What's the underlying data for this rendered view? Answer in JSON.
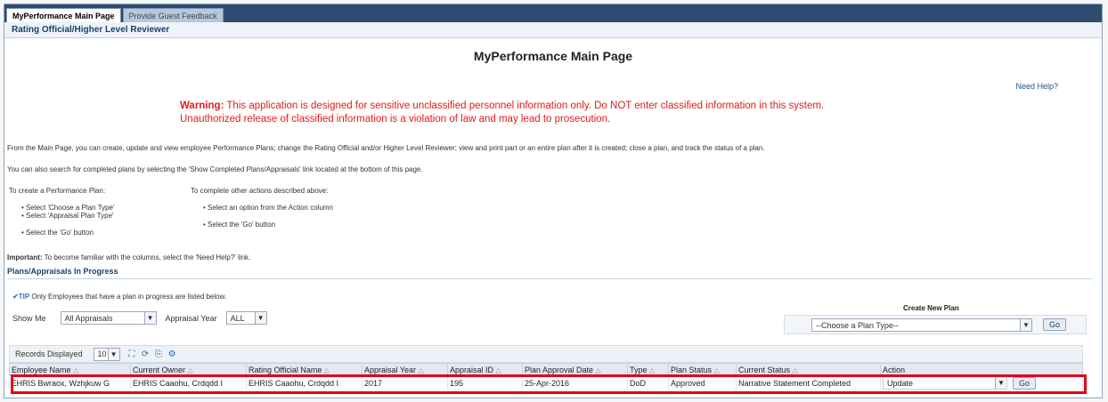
{
  "tabs": [
    {
      "label": "MyPerformance Main Page"
    },
    {
      "label": "Provide Guest Feedback"
    }
  ],
  "role_title": "Rating Official/Higher Level Reviewer",
  "page_title": "MyPerformance Main Page",
  "need_help": "Need Help?",
  "warning": {
    "prefix": "Warning:",
    "line1": " This application is designed for sensitive unclassified personnel information only. Do NOT enter classified information in this system.",
    "line2": "Unauthorized release of classified information is a violation of law and may lead to prosecution."
  },
  "intro": {
    "p1": "From the Main Page, you can create, update and view employee Performance Plans; change the Rating Official and/or Higher Level Reviewer; view and print part or an entire plan after it is created; close a plan, and track the status of a plan.",
    "p2": "You can also search for completed plans by selecting the 'Show Completed Plans/Appraisals' link located at the bottom of this page."
  },
  "instructions": {
    "create_heading": "To create a Performance Plan:",
    "create_steps": [
      "Select 'Choose a Plan Type'",
      "Select 'Appraisal Plan Type'",
      "Select the 'Go' button"
    ],
    "other_heading": "To complete other actions described above:",
    "other_steps": [
      "Select an option from the Action column",
      "Select the 'Go' button"
    ]
  },
  "important": {
    "label": "Important:",
    "text": " To become familiar with the columns, select the 'Need Help?' link."
  },
  "section_title": "Plans/Appraisals In Progress",
  "tip": {
    "badge": "TIP",
    "text": " Only Employees that have a plan in progress are listed below."
  },
  "filters": {
    "show_me_label": "Show Me",
    "show_me_value": "All Appraisals",
    "year_label": "Appraisal Year",
    "year_value": "ALL"
  },
  "create_plan": {
    "label": "Create New Plan",
    "placeholder": "--Choose a Plan Type--",
    "go": "Go"
  },
  "records": {
    "label": "Records Displayed",
    "value": "10"
  },
  "table": {
    "columns": [
      "Employee Name",
      "Current Owner",
      "Rating Official Name",
      "Appraisal Year",
      "Appraisal ID",
      "Plan Approval Date",
      "Type",
      "Plan Status",
      "Current Status",
      "Action"
    ],
    "rows": [
      {
        "employee_name": "EHRIS Bwraox, Wzhjkuw G",
        "current_owner": "EHRIS Caaohu, Crdqdd I",
        "rating_official": "EHRIS Caaohu, Crdqdd I",
        "appraisal_year": "2017",
        "appraisal_id": "195",
        "approval_date": "25-Apr-2016",
        "type": "DoD",
        "plan_status": "Approved",
        "current_status": "Narrative Statement Completed",
        "action": "Update",
        "go": "Go"
      }
    ]
  },
  "colors": {
    "header_bar": "#2e4c70",
    "warning_red": "#e21b1b",
    "highlight_red": "#e0001b",
    "link_blue": "#1f4e8c"
  }
}
